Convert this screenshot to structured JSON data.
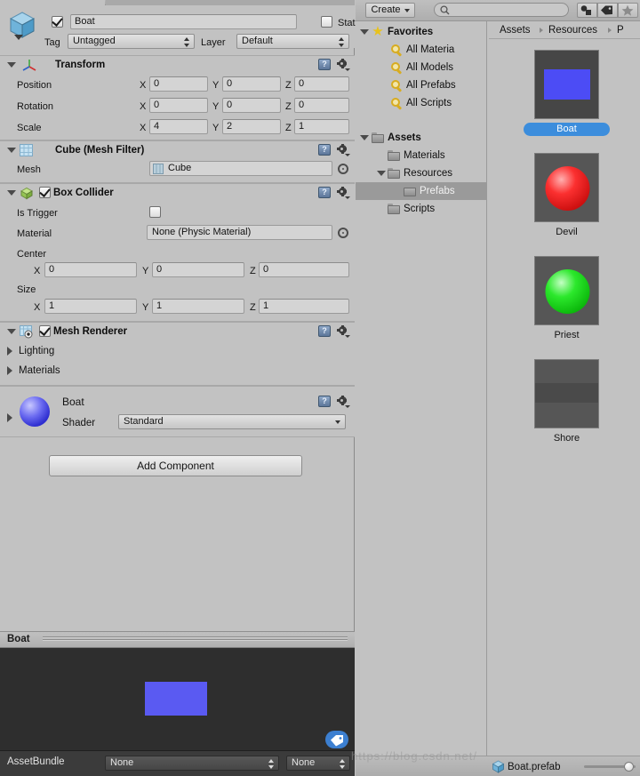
{
  "inspector": {
    "gameobject": {
      "icon": "cube-icon",
      "active": true,
      "name": "Boat",
      "static_label": "Static",
      "static_checked": false,
      "tag_label": "Tag",
      "tag_value": "Untagged",
      "layer_label": "Layer",
      "layer_value": "Default"
    },
    "components": [
      {
        "id": "transform",
        "title": "Transform",
        "icon": "transform-axis-icon",
        "expanded": true,
        "rows": [
          {
            "label": "Position",
            "x": "0",
            "y": "0",
            "z": "0"
          },
          {
            "label": "Rotation",
            "x": "0",
            "y": "0",
            "z": "0"
          },
          {
            "label": "Scale",
            "x": "4",
            "y": "2",
            "z": "1"
          }
        ],
        "axis_labels": [
          "X",
          "Y",
          "Z"
        ]
      },
      {
        "id": "mesh-filter",
        "title": "Cube (Mesh Filter)",
        "icon": "mesh-filter-icon",
        "expanded": true,
        "mesh_label": "Mesh",
        "mesh_value": "Cube"
      },
      {
        "id": "box-collider",
        "title": "Box Collider",
        "icon": "box-collider-icon",
        "expanded": true,
        "enabled": true,
        "is_trigger_label": "Is Trigger",
        "is_trigger_checked": false,
        "material_label": "Material",
        "material_value": "None (Physic Material)",
        "center_label": "Center",
        "center": {
          "x": "0",
          "y": "0",
          "z": "0"
        },
        "size_label": "Size",
        "size": {
          "x": "1",
          "y": "1",
          "z": "1"
        },
        "axis_labels": [
          "X",
          "Y",
          "Z"
        ]
      },
      {
        "id": "mesh-renderer",
        "title": "Mesh Renderer",
        "icon": "mesh-renderer-icon",
        "expanded": true,
        "enabled": true,
        "foldouts": [
          "Lighting",
          "Materials"
        ]
      },
      {
        "id": "material",
        "title": "Boat",
        "icon": "material-sphere-icon",
        "expanded": false,
        "shader_label": "Shader",
        "shader_value": "Standard"
      }
    ],
    "add_component_label": "Add Component",
    "preview": {
      "title": "Boat",
      "assetbundle_label": "AssetBundle",
      "bundle_value": "None",
      "variant_value": "None",
      "tag_badge_icon": "tag-icon"
    }
  },
  "project": {
    "toolbar": {
      "create_label": "Create",
      "search_placeholder": "",
      "search_value": "",
      "search_icon": "search-icon",
      "filters": [
        "type-filter-icon",
        "label-filter-icon",
        "favorite-filter-icon"
      ]
    },
    "breadcrumb": [
      "Assets",
      "Resources",
      "P"
    ],
    "tree": [
      {
        "label": "Favorites",
        "icon": "star-icon",
        "depth": 0,
        "bold": true,
        "expanded": true,
        "selected": false
      },
      {
        "label": "All Materia",
        "icon": "search-icon",
        "depth": 1,
        "bold": false,
        "expanded": null,
        "selected": false
      },
      {
        "label": "All Models",
        "icon": "search-icon",
        "depth": 1,
        "bold": false,
        "expanded": null,
        "selected": false
      },
      {
        "label": "All Prefabs",
        "icon": "search-icon",
        "depth": 1,
        "bold": false,
        "expanded": null,
        "selected": false
      },
      {
        "label": "All Scripts",
        "icon": "search-icon",
        "depth": 1,
        "bold": false,
        "expanded": null,
        "selected": false
      },
      {
        "label": "Assets",
        "icon": "folder-icon",
        "depth": 0,
        "bold": true,
        "expanded": true,
        "selected": false
      },
      {
        "label": "Materials",
        "icon": "folder-icon",
        "depth": 1,
        "bold": false,
        "expanded": null,
        "selected": false
      },
      {
        "label": "Resources",
        "icon": "folder-icon",
        "depth": 1,
        "bold": false,
        "expanded": true,
        "selected": false
      },
      {
        "label": "Prefabs",
        "icon": "folder-icon",
        "depth": 2,
        "bold": false,
        "expanded": null,
        "selected": true
      },
      {
        "label": "Scripts",
        "icon": "folder-icon",
        "depth": 1,
        "bold": false,
        "expanded": null,
        "selected": false
      }
    ],
    "assets": [
      {
        "name": "Boat",
        "shape": "rect",
        "color": "#4c4cf5",
        "selected": true
      },
      {
        "name": "Devil",
        "shape": "sphere",
        "color": "#fb3030",
        "selected": false
      },
      {
        "name": "Priest",
        "shape": "sphere",
        "color": "#2ce82c",
        "selected": false
      },
      {
        "name": "Shore",
        "shape": "band",
        "color": "#4a4a4a",
        "selected": false
      }
    ],
    "footer": {
      "selected_asset": "Boat.prefab",
      "icon": "prefab-cube-icon",
      "zoom_value": 100
    }
  },
  "watermark": "https://blog.csdn.net/"
}
